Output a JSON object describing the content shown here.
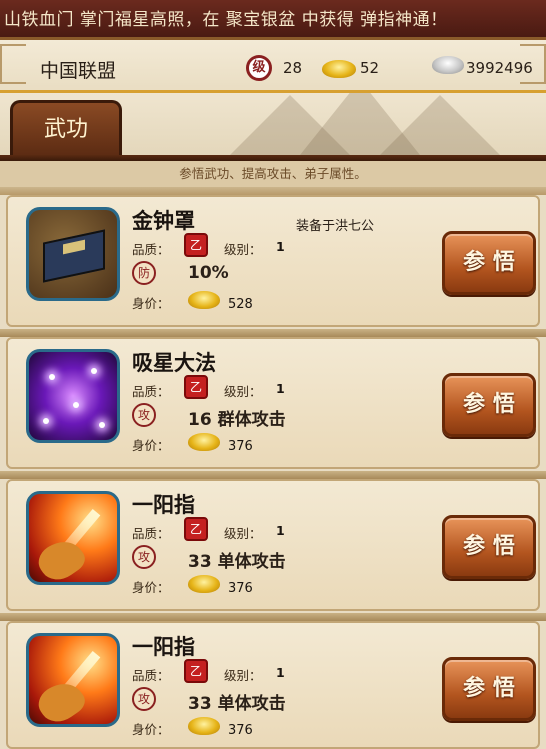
{
  "marquee": {
    "text": "山铁血门 掌门福星高照，在 聚宝银盆 中获得 弹指神通！"
  },
  "header": {
    "alliance": "中国联盟",
    "level_icon_text": "级",
    "level": "28",
    "gold": "52",
    "silver": "3992496"
  },
  "tab": {
    "label": "武功"
  },
  "subtitle": "参悟武功、提高攻击、弟子属性。",
  "labels": {
    "quality": "品质：",
    "level": "级别：",
    "price": "身价：",
    "comprehend": "参 悟"
  },
  "skills": [
    {
      "name": "金钟罩",
      "equipped": "装备于洪七公",
      "quality_badge": "乙",
      "level": "1",
      "stat_icon": "防",
      "stat": "10%",
      "price": "528",
      "icon": "book-icon"
    },
    {
      "name": "吸星大法",
      "equipped": "",
      "quality_badge": "乙",
      "level": "1",
      "stat_icon": "攻",
      "stat": "16 群体攻击",
      "price": "376",
      "icon": "purple-stars-icon"
    },
    {
      "name": "一阳指",
      "equipped": "",
      "quality_badge": "乙",
      "level": "1",
      "stat_icon": "攻",
      "stat": "33 单体攻击",
      "price": "376",
      "icon": "finger-icon"
    },
    {
      "name": "一阳指",
      "equipped": "",
      "quality_badge": "乙",
      "level": "1",
      "stat_icon": "攻",
      "stat": "33 单体攻击",
      "price": "376",
      "icon": "finger-icon"
    }
  ],
  "colors": {
    "accent": "#b3551f",
    "brand_dark": "#5a2a12",
    "gold_line": "#d7a030"
  }
}
